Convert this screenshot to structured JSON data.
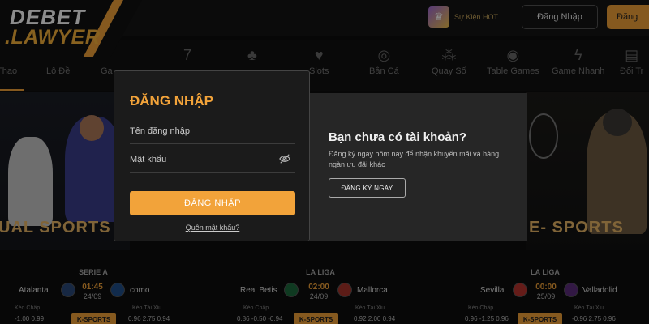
{
  "brand": {
    "line1": "DEBET",
    "line2": ".LAWYER"
  },
  "header": {
    "event_label": "Sự Kiện HOT",
    "login_button": "Đăng Nhập",
    "register_button": "Đăng"
  },
  "nav": {
    "items": [
      {
        "label": "Thao",
        "icon": "trophy-icon"
      },
      {
        "label": "Lô Đề",
        "icon": "lottery-icon"
      },
      {
        "label": "Ga",
        "icon": "game-icon"
      },
      {
        "label": "",
        "icon": "seven-icon"
      },
      {
        "label": "",
        "icon": "clubs-icon"
      },
      {
        "label": "Slots",
        "icon": "cherry-icon"
      },
      {
        "label": "Bắn Cá",
        "icon": "fish-icon"
      },
      {
        "label": "Quay Số",
        "icon": "balls-icon"
      },
      {
        "label": "Table Games",
        "icon": "chips-icon"
      },
      {
        "label": "Game Nhanh",
        "icon": "bolt-icon"
      },
      {
        "label": "Đối Tr",
        "icon": "cards-icon"
      }
    ]
  },
  "banners": {
    "left_title": "UAL SPORTS",
    "right_title": "E- SPORTS"
  },
  "matches": [
    {
      "league": "SERIE A",
      "home": "Atalanta",
      "away": "como",
      "time": "01:45",
      "date": "24/09",
      "handicap_label": "Kèo Chấp",
      "total_label": "Kèo Tài Xỉu",
      "odds_left": "-1.00   0.99",
      "odds_right": "0.96  2.75  0.94",
      "provider": "K-SPORTS"
    },
    {
      "league": "LA LIGA",
      "home": "Real Betis",
      "away": "Mallorca",
      "time": "02:00",
      "date": "24/09",
      "handicap_label": "Kèo Chấp",
      "total_label": "Kèo Tài Xỉu",
      "odds_left": "0.86  -0.50  -0.94",
      "odds_right": "0.92  2.00  0.94",
      "provider": "K-SPORTS"
    },
    {
      "league": "LA LIGA",
      "home": "Sevilla",
      "away": "Valladolid",
      "time": "00:00",
      "date": "25/09",
      "handicap_label": "Kèo Chấp",
      "total_label": "Kèo Tài Xỉu",
      "odds_left": "0.96  -1.25  0.96",
      "odds_right": "-0.96  2.75  0.96",
      "provider": "K-SPORTS"
    }
  ],
  "login": {
    "title": "ĐĂNG NHẬP",
    "username_placeholder": "Tên đăng nhập",
    "password_placeholder": "Mật khẩu",
    "submit": "ĐĂNG NHẬP",
    "forgot": "Quên mật khẩu?"
  },
  "promo": {
    "title": "Bạn chưa có tài khoản?",
    "description": "Đăng ký ngay hôm nay để nhận khuyến mãi và hàng ngàn ưu đãi khác",
    "button": "ĐĂNG KÝ NGAY"
  },
  "colors": {
    "accent": "#f2a33a",
    "background": "#0d0d0d",
    "panel": "#1b1b1b"
  }
}
